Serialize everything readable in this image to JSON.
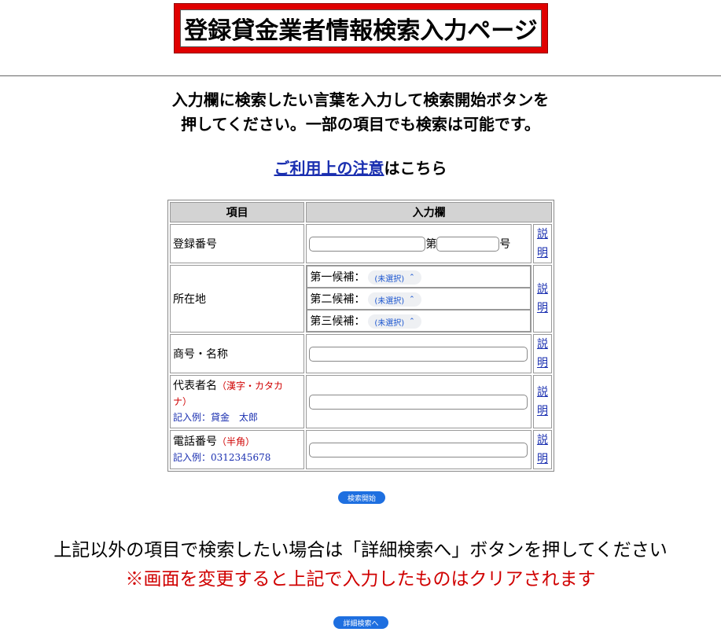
{
  "header": {
    "title": "登録貸金業者情報検索入力ページ"
  },
  "intro": {
    "line1": "入力欄に検索したい言葉を入力して検索開始ボタンを",
    "line2": "押してください。一部の項目でも検索は可能です。"
  },
  "notice": {
    "link": "ご利用上の注意",
    "suffix": "はこちら"
  },
  "table": {
    "headers": {
      "item": "項目",
      "input": "入力欄"
    },
    "help_label_1": "説",
    "help_label_2": "明",
    "registration": {
      "label": "登録番号",
      "dai": "第",
      "go": "号"
    },
    "location": {
      "label": "所在地",
      "candidates": [
        {
          "label": "第一候補：",
          "value": "(未選択)"
        },
        {
          "label": "第二候補：",
          "value": "(未選択)"
        },
        {
          "label": "第三候補：",
          "value": "(未選択)"
        }
      ]
    },
    "company": {
      "label": "商号・名称"
    },
    "representative": {
      "label": "代表者名",
      "note": "（漢字・カタカナ）",
      "example": "記入例：貸金　太郎"
    },
    "phone": {
      "label": "電話番号",
      "note": "（半角）",
      "example": "記入例：0312345678"
    }
  },
  "buttons": {
    "search": "検索開始",
    "detail": "詳細検索へ"
  },
  "footer": {
    "line1": "上記以外の項目で検索したい場合は「詳細検索へ」ボタンを押してください",
    "line2": "※画面を変更すると上記で入力したものはクリアされます"
  },
  "colors": {
    "accent_red": "#e00000",
    "link_blue": "#1a2fb0",
    "button_blue": "#1e6fe0"
  }
}
